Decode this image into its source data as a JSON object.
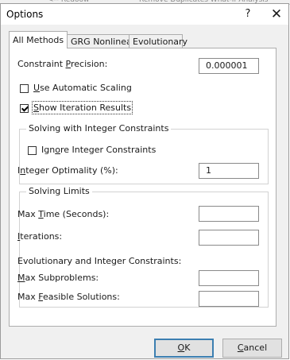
{
  "window": {
    "title": "Options",
    "help_glyph": "?",
    "close_glyph": "✕"
  },
  "tabs": [
    {
      "label": "All Methods",
      "selected": true
    },
    {
      "label": "GRG Nonlinear",
      "selected": false
    },
    {
      "label": "Evolutionary",
      "selected": false
    }
  ],
  "constraint_precision": {
    "pre": "Constraint ",
    "u": "P",
    "post": "recision:",
    "value": "0.000001"
  },
  "use_automatic_scaling": {
    "u": "U",
    "post": "se Automatic Scaling",
    "checked": false
  },
  "show_iteration_results": {
    "u": "S",
    "post": "how Iteration Results",
    "checked": true
  },
  "integer_group": {
    "title": "Solving with Integer Constraints",
    "ignore": {
      "pre": "Ign",
      "u": "o",
      "post": "re Integer Constraints",
      "checked": false
    },
    "optimality": {
      "pre": "I",
      "u": "n",
      "post": "teger Optimality (%):",
      "value": "1"
    }
  },
  "limits_group": {
    "title": "Solving Limits",
    "max_time": {
      "pre": "Max ",
      "u": "T",
      "post": "ime (Seconds):",
      "value": ""
    },
    "iterations": {
      "pre": "",
      "u": "I",
      "post": "terations:",
      "value": ""
    },
    "evo_heading": "Evolutionary and Integer Constraints:",
    "max_subproblems": {
      "pre": "",
      "u": "M",
      "post": "ax Subproblems:",
      "value": ""
    },
    "max_feasible": {
      "pre": "Max ",
      "u": "F",
      "post": "easible Solutions:",
      "value": ""
    }
  },
  "buttons": {
    "ok": {
      "u": "O",
      "post": "K"
    },
    "cancel": {
      "u": "C",
      "post": "ancel"
    }
  }
}
